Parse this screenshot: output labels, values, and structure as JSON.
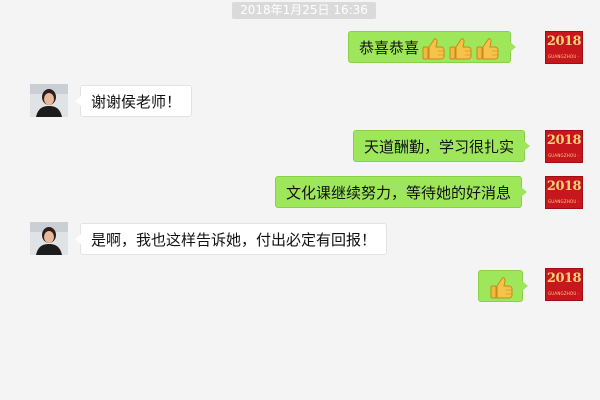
{
  "chat": {
    "timestamp": "2018年1月25日 16:36",
    "badge": {
      "year": "2018",
      "subtitle": "GUANGZHOU · XINCHUN"
    },
    "messages": [
      {
        "side": "right",
        "text": "恭喜恭喜",
        "emojis": [
          "thumbs-up",
          "thumbs-up",
          "thumbs-up"
        ]
      },
      {
        "side": "left",
        "text": "谢谢侯老师！"
      },
      {
        "side": "right",
        "text": "天道酬勤，学习很扎实"
      },
      {
        "side": "right",
        "text": "文化课继续努力，等待她的好消息"
      },
      {
        "side": "left",
        "text": "是啊，我也这样告诉她，付出必定有回报！"
      },
      {
        "side": "right",
        "text": "",
        "emojis": [
          "thumbs-up"
        ]
      }
    ]
  }
}
